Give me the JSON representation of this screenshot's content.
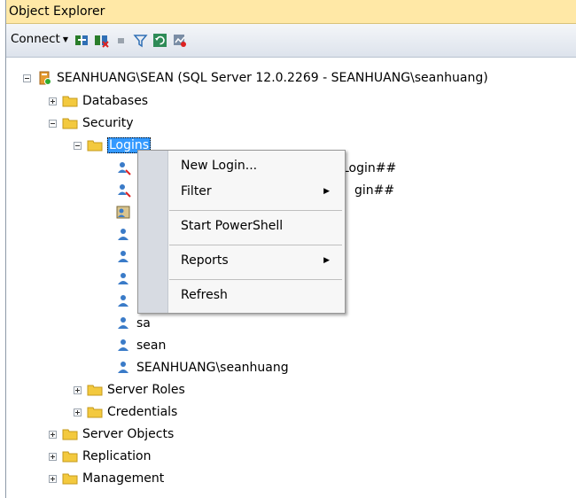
{
  "panel": {
    "title": "Object Explorer"
  },
  "toolbar": {
    "connect_label": "Connect",
    "buttons": [
      "connect-db-icon",
      "disconnect-icon",
      "stop-icon",
      "filter-icon",
      "refresh-icon",
      "activity-icon"
    ]
  },
  "tree": {
    "server": "SEANHUANG\\SEAN (SQL Server 12.0.2269 - SEANHUANG\\seanhuang)",
    "databases": "Databases",
    "security": "Security",
    "logins": "Logins",
    "login_items": [
      "##MS_PolicyEventProcessingLogin##",
      "##MS_PolicyTsqlExecutionLogin##",
      "",
      "",
      "",
      "",
      "",
      "sa",
      "sean",
      "SEANHUANG\\seanhuang"
    ],
    "login_items_visible_partial": [
      "Login##",
      "gin##"
    ],
    "server_roles": "Server Roles",
    "credentials": "Credentials",
    "server_objects": "Server Objects",
    "replication": "Replication",
    "management": "Management"
  },
  "context_menu": {
    "items": [
      {
        "label": "New Login...",
        "submenu": false
      },
      {
        "label": "Filter",
        "submenu": true
      },
      {
        "label": "Start PowerShell",
        "submenu": false
      },
      {
        "label": "Reports",
        "submenu": true
      },
      {
        "label": "Refresh",
        "submenu": false
      }
    ]
  },
  "colors": {
    "title_bg": "#ffe8a6",
    "selection": "#3399ff",
    "folder": "#f3c93e"
  }
}
